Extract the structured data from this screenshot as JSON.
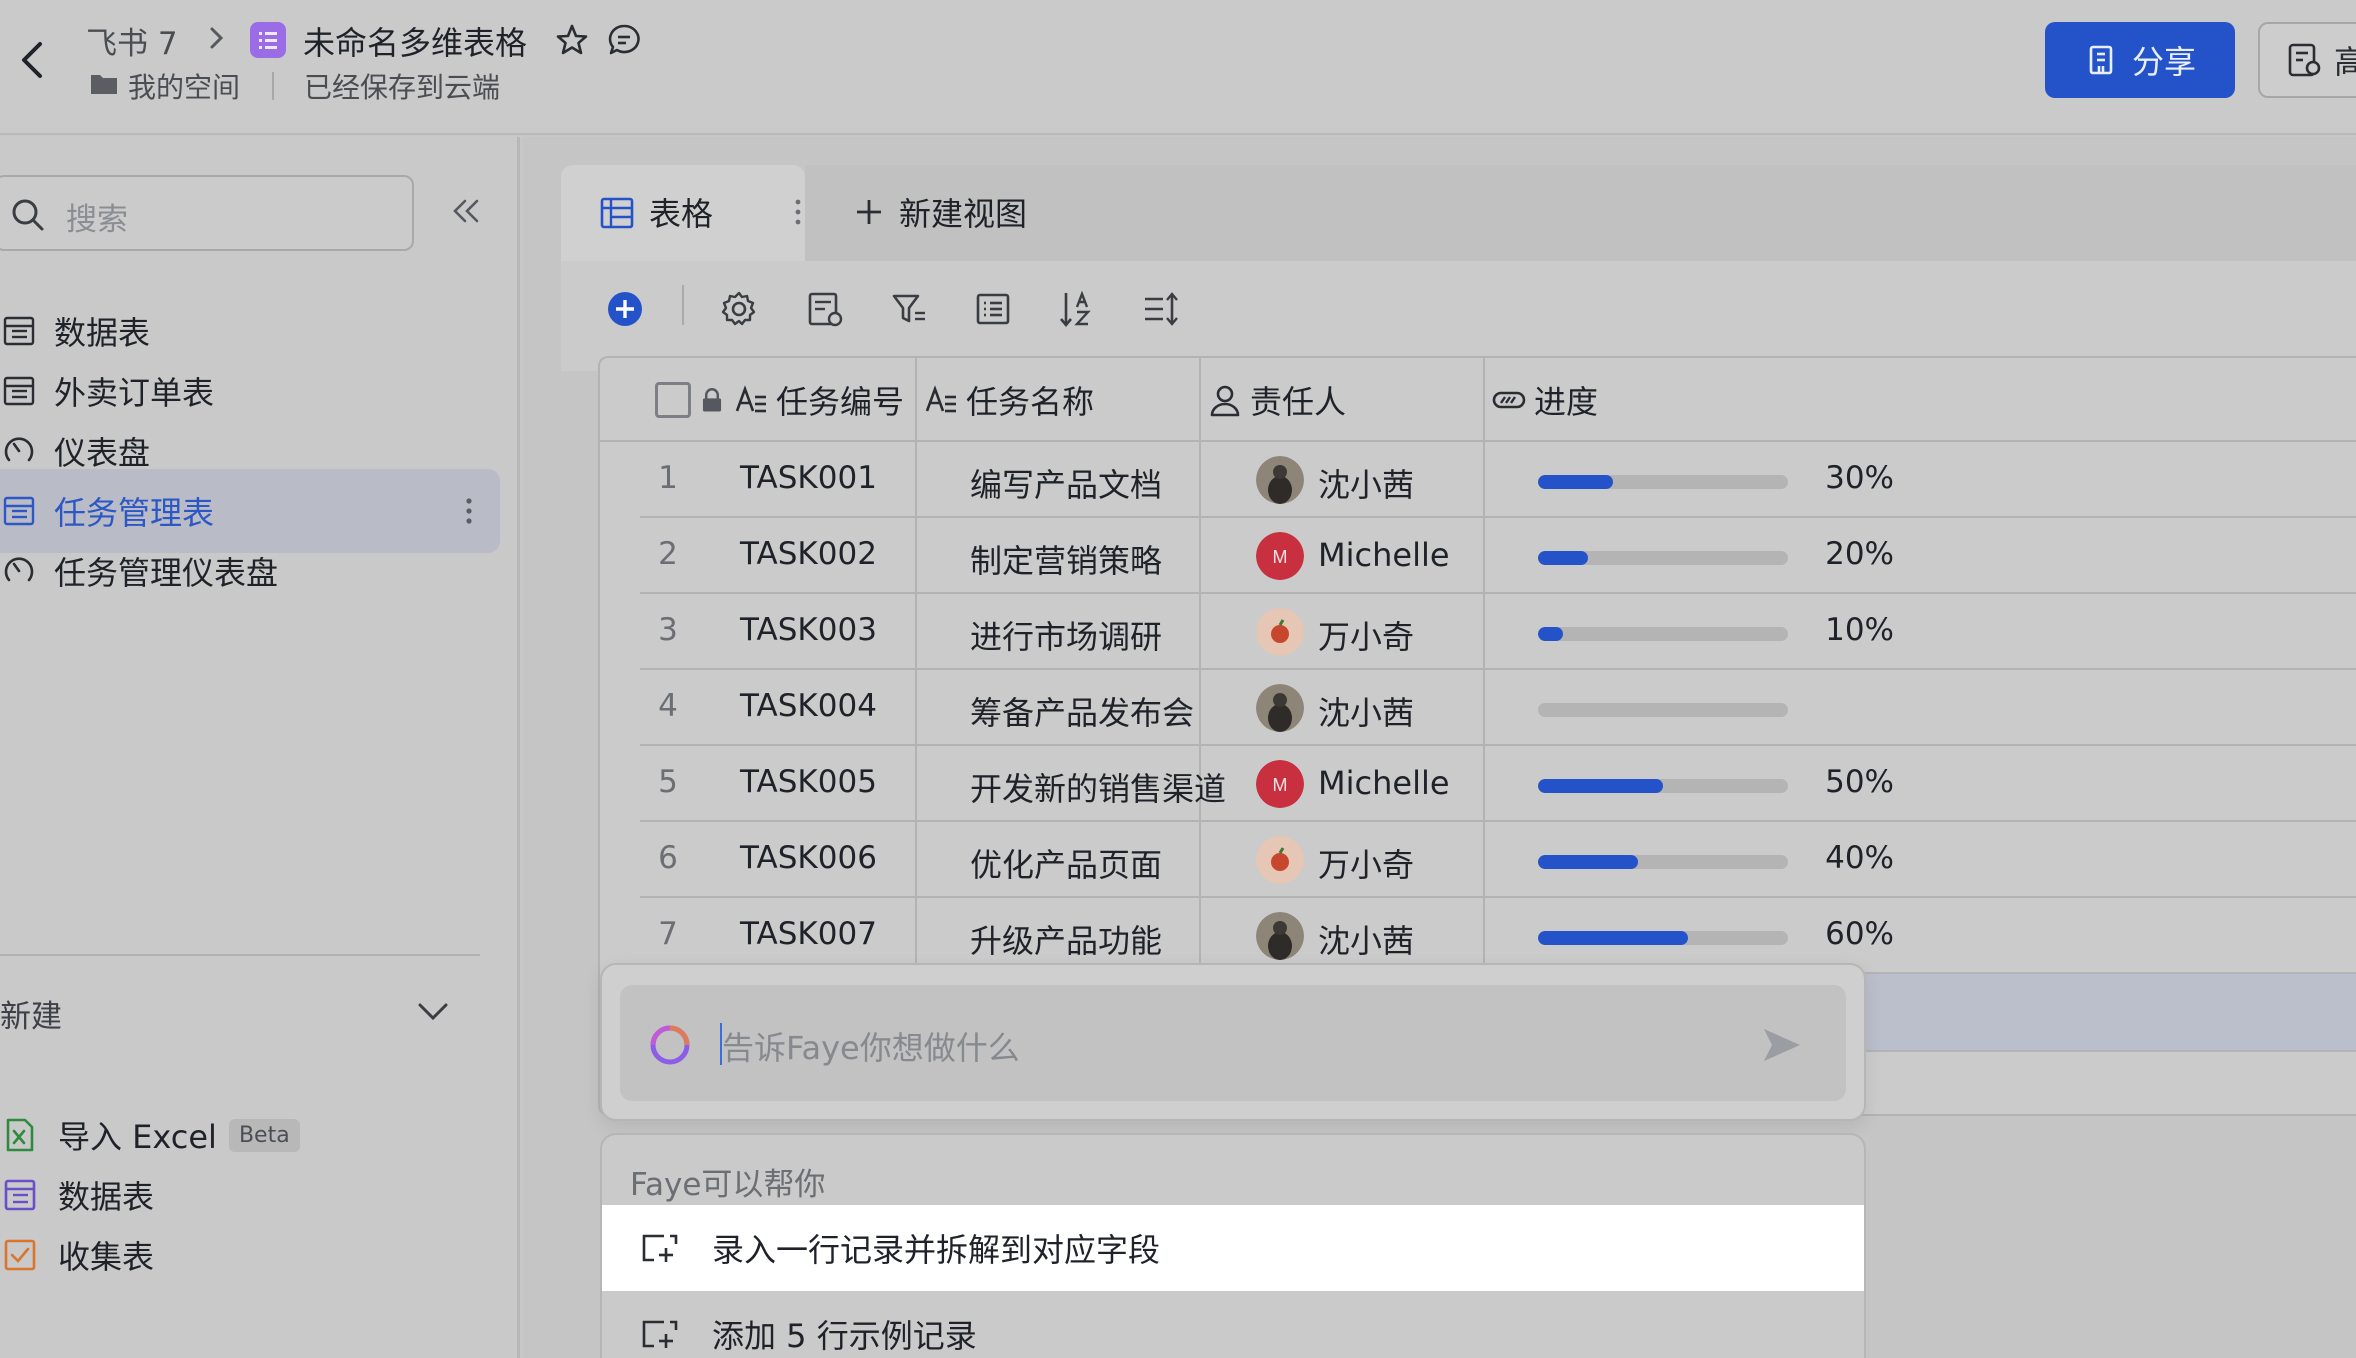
{
  "header": {
    "parent": "飞书 7",
    "title": "未命名多维表格",
    "location": "我的空间",
    "save_status": "已经保存到云端",
    "share_label": "分享",
    "right_button_label": "高"
  },
  "sidebar": {
    "search_placeholder": "搜索",
    "items": [
      {
        "label": "数据表",
        "icon": "table-icon"
      },
      {
        "label": "外卖订单表",
        "icon": "table-icon"
      },
      {
        "label": "仪表盘",
        "icon": "dashboard-icon"
      },
      {
        "label": "任务管理表",
        "icon": "table-icon",
        "active": true
      },
      {
        "label": "任务管理仪表盘",
        "icon": "dashboard-icon"
      }
    ],
    "new_label": "新建",
    "create_items": [
      {
        "label": "导入 Excel",
        "badge": "Beta",
        "icon": "excel-icon"
      },
      {
        "label": "数据表",
        "icon": "table-icon"
      },
      {
        "label": "收集表",
        "icon": "form-icon"
      }
    ]
  },
  "view": {
    "tab_label": "表格",
    "new_view_label": "新建视图"
  },
  "table": {
    "columns": [
      "任务编号",
      "任务名称",
      "责任人",
      "进度"
    ],
    "rows": [
      {
        "num": "1",
        "id": "TASK001",
        "name": "编写产品文档",
        "owner": "沈小茜",
        "progress": 0.3,
        "progress_label": "30%"
      },
      {
        "num": "2",
        "id": "TASK002",
        "name": "制定营销策略",
        "owner": "Michelle",
        "progress": 0.2,
        "progress_label": "20%"
      },
      {
        "num": "3",
        "id": "TASK003",
        "name": "进行市场调研",
        "owner": "万小奇",
        "progress": 0.1,
        "progress_label": "10%"
      },
      {
        "num": "4",
        "id": "TASK004",
        "name": "筹备产品发布会",
        "owner": "沈小茜",
        "progress": 0,
        "progress_label": ""
      },
      {
        "num": "5",
        "id": "TASK005",
        "name": "开发新的销售渠道",
        "owner": "Michelle",
        "progress": 0.5,
        "progress_label": "50%"
      },
      {
        "num": "6",
        "id": "TASK006",
        "name": "优化产品页面",
        "owner": "万小奇",
        "progress": 0.4,
        "progress_label": "40%"
      },
      {
        "num": "7",
        "id": "TASK007",
        "name": "升级产品功能",
        "owner": "沈小茜",
        "progress": 0.6,
        "progress_label": "60%"
      }
    ]
  },
  "ai": {
    "placeholder": "告诉Faye你想做什么",
    "suggest_title": "Faye可以帮你",
    "suggestions": [
      "录入一行记录并拆解到对应字段",
      "添加 5 行示例记录"
    ]
  },
  "colors": {
    "accent": "#2453c9",
    "doc_icon": "#9a6de6",
    "avatar_michelle": "#c8303f"
  }
}
